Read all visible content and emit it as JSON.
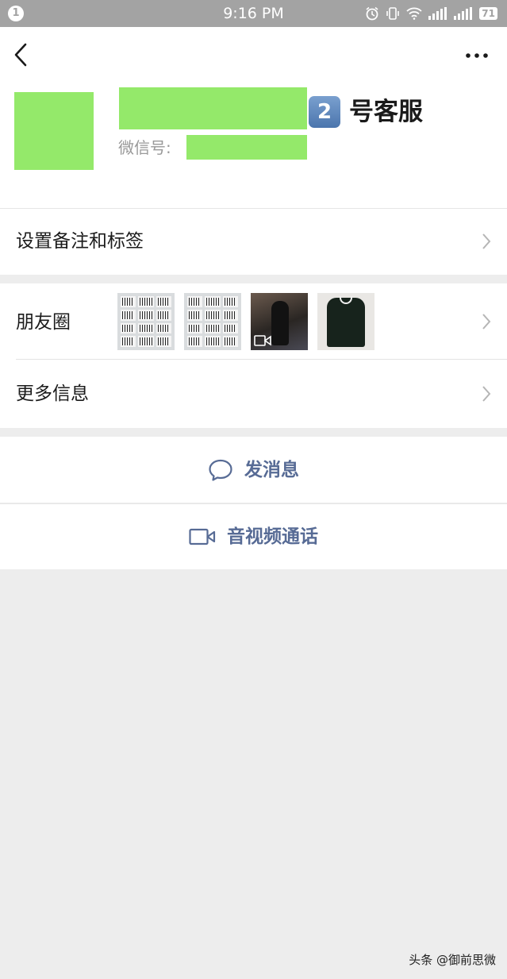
{
  "status_bar": {
    "notification_count": "1",
    "time": "9:16 PM",
    "battery": "71",
    "icons": [
      "alarm-icon",
      "vibrate-icon",
      "wifi-icon",
      "signal-icon",
      "signal-icon",
      "battery-icon"
    ]
  },
  "header": {
    "back_icon": "chevron-left-icon",
    "more_icon": "more-icon"
  },
  "profile": {
    "name_number": "2",
    "name_suffix": "号客服",
    "wechat_id_label": "微信号:"
  },
  "rows": {
    "remark": {
      "label": "设置备注和标签"
    },
    "moments": {
      "label": "朋友圈"
    },
    "more_info": {
      "label": "更多信息"
    }
  },
  "actions": {
    "send_message": {
      "label": "发消息",
      "icon": "chat-bubble-icon"
    },
    "video_call": {
      "label": "音视频通话",
      "icon": "video-camera-icon"
    }
  },
  "watermark": "头条 @御前思微",
  "colors": {
    "redaction": "#94e96a",
    "link": "#576b95",
    "status_bar": "#a3a3a3",
    "background": "#ededed"
  }
}
